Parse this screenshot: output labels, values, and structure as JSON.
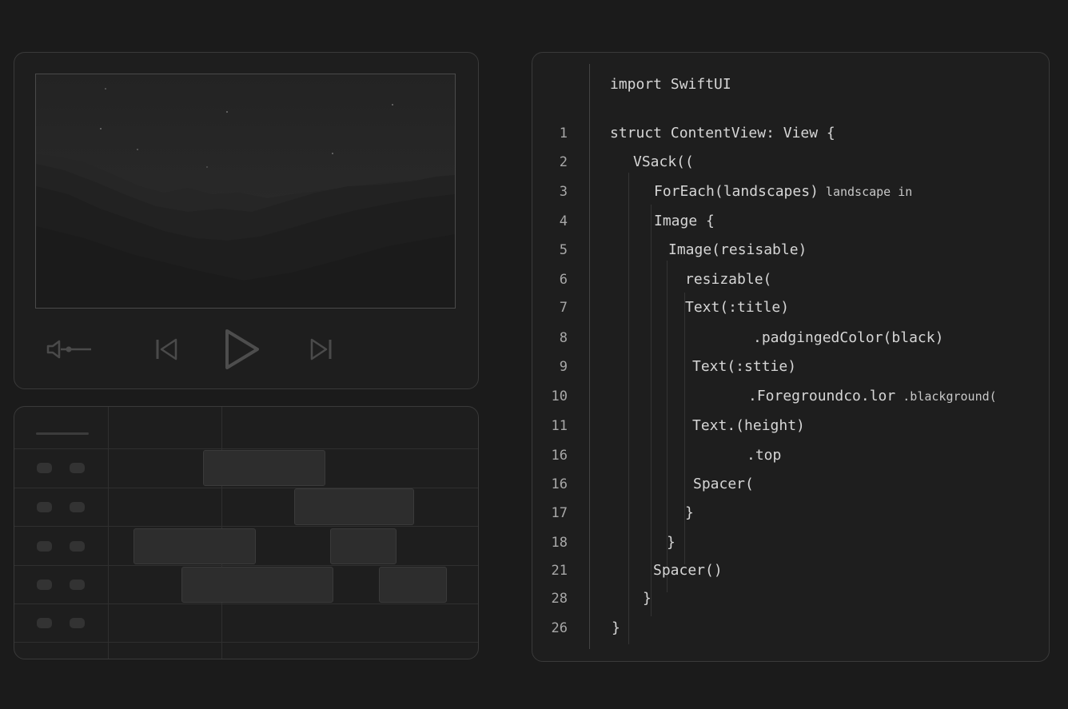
{
  "player": {
    "controls": {
      "volume_icon": "speaker-icon",
      "prev_icon": "skip-back-icon",
      "play_icon": "play-icon",
      "next_icon": "skip-forward-icon"
    },
    "colors": {
      "sky": "#2a2a2a",
      "mountain": "#1f1f1f"
    }
  },
  "timeline": {
    "track_count": 5,
    "toggle_icon": "track-toggle-icon"
  },
  "code": {
    "language": "Swift",
    "lines": [
      {
        "num": "",
        "text": "import SwiftUI"
      },
      {
        "num": "1",
        "text": "struct ContentView: View {"
      },
      {
        "num": "2",
        "text": "VSack(("
      },
      {
        "num": "3",
        "text": "ForEach(landscapes)",
        "small": " landscape in"
      },
      {
        "num": "4",
        "text": "Image {"
      },
      {
        "num": "5",
        "text": "Image(resisable)"
      },
      {
        "num": "6",
        "text": "resizable("
      },
      {
        "num": "7",
        "text": "Text(:title)"
      },
      {
        "num": "8",
        "text": ".padgingedColor(black)"
      },
      {
        "num": "9",
        "text": "Text(:sttie)"
      },
      {
        "num": "10",
        "text": ".Foregroundco.lor",
        "small": " .blackground("
      },
      {
        "num": "11",
        "text": "Text.(height)"
      },
      {
        "num": "16",
        "text": ".top"
      },
      {
        "num": "16",
        "text": "Spacer("
      },
      {
        "num": "17",
        "text": "}"
      },
      {
        "num": "18",
        "text": "}"
      },
      {
        "num": "21",
        "text": "Spacer()"
      },
      {
        "num": "28",
        "text": "}"
      },
      {
        "num": "26",
        "text": "}"
      }
    ],
    "colors": {
      "text": "#d6d6d6",
      "line_number": "#a8a8a8"
    }
  }
}
